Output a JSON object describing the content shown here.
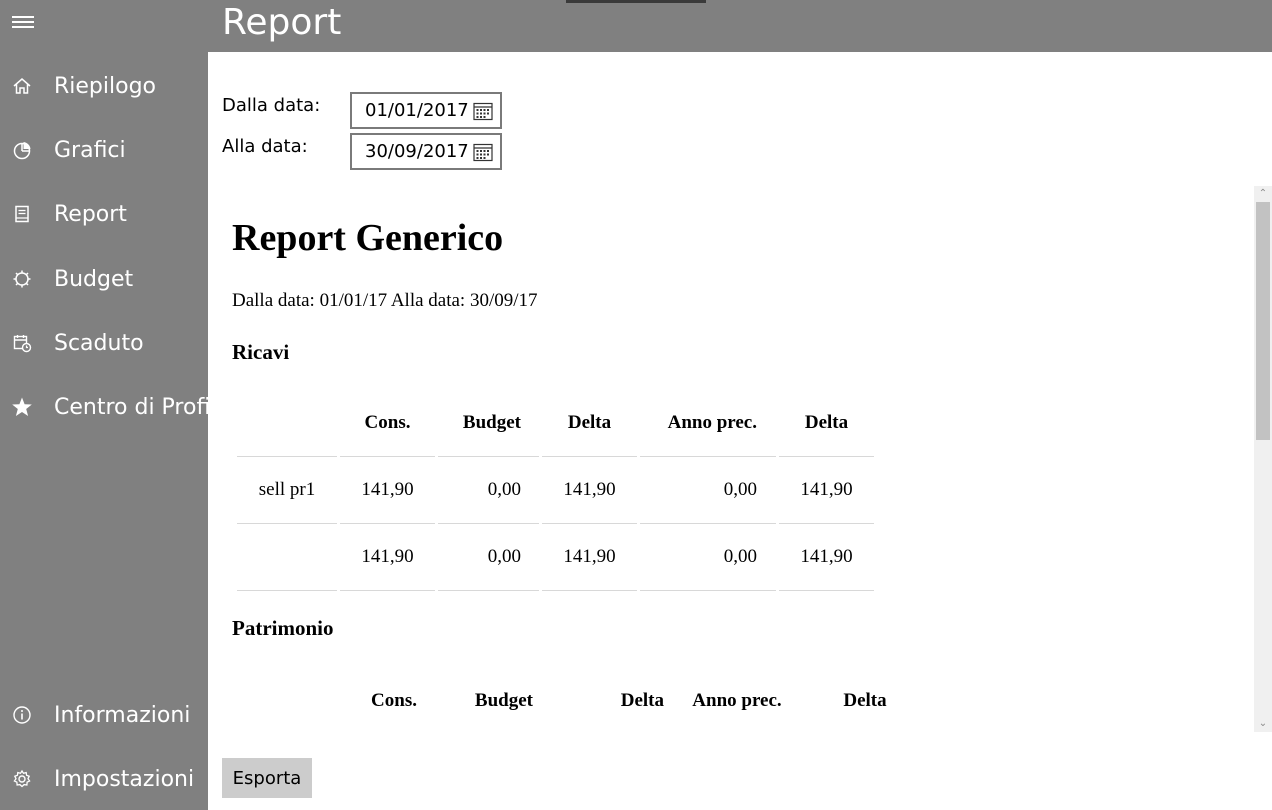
{
  "header": {
    "title": "Report"
  },
  "sidebar": {
    "items": [
      {
        "label": "Riepilogo",
        "icon": "home-icon"
      },
      {
        "label": "Grafici",
        "icon": "pie-chart-icon"
      },
      {
        "label": "Report",
        "icon": "report-icon"
      },
      {
        "label": "Budget",
        "icon": "budget-icon"
      },
      {
        "label": "Scaduto",
        "icon": "calendar-clock-icon"
      },
      {
        "label": "Centro di Profitto",
        "icon": "star-icon"
      }
    ],
    "bottom_items": [
      {
        "label": "Informazioni",
        "icon": "info-icon"
      },
      {
        "label": "Impostazioni",
        "icon": "gear-icon"
      }
    ]
  },
  "filters": {
    "from_label": "Dalla data:",
    "from_value": "01/01/2017",
    "to_label": "Alla data:",
    "to_value": "30/09/2017"
  },
  "report": {
    "title": "Report Generico",
    "range_text": "Dalla data: 01/01/17 Alla data: 30/09/17",
    "columns": [
      "",
      "Cons.",
      "Budget",
      "Delta",
      "Anno prec.",
      "Delta"
    ],
    "sections": [
      {
        "title": "Ricavi",
        "rows": [
          [
            "sell pr1",
            "141,90",
            "0,00",
            "141,90",
            "0,00",
            "141,90"
          ],
          [
            "",
            "141,90",
            "0,00",
            "141,90",
            "0,00",
            "141,90"
          ]
        ]
      },
      {
        "title": "Patrimonio",
        "rows": []
      }
    ]
  },
  "actions": {
    "export_label": "Esporta"
  }
}
